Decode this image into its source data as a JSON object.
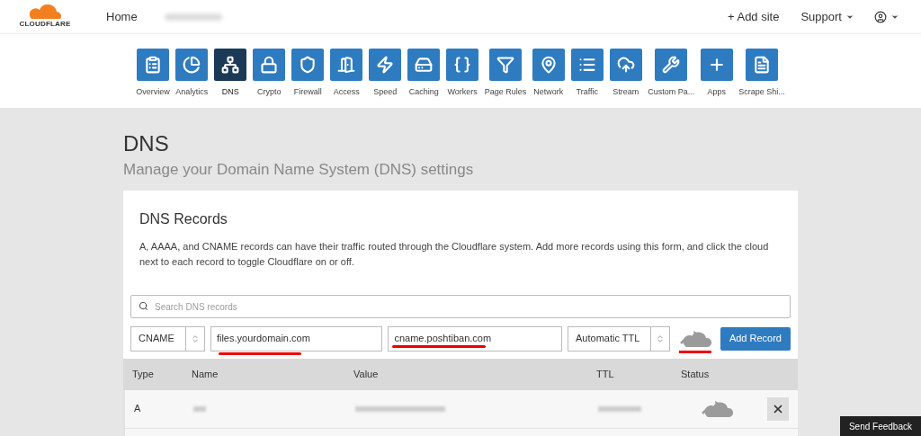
{
  "header": {
    "logo": "CLOUDFLARE",
    "home": "Home",
    "add_site": "+ Add site",
    "support": "Support"
  },
  "nav": [
    {
      "label": "Overview",
      "selected": false
    },
    {
      "label": "Analytics",
      "selected": false
    },
    {
      "label": "DNS",
      "selected": true
    },
    {
      "label": "Crypto",
      "selected": false
    },
    {
      "label": "Firewall",
      "selected": false
    },
    {
      "label": "Access",
      "selected": false
    },
    {
      "label": "Speed",
      "selected": false
    },
    {
      "label": "Caching",
      "selected": false
    },
    {
      "label": "Workers",
      "selected": false
    },
    {
      "label": "Page Rules",
      "selected": false
    },
    {
      "label": "Network",
      "selected": false
    },
    {
      "label": "Traffic",
      "selected": false
    },
    {
      "label": "Stream",
      "selected": false
    },
    {
      "label": "Custom Pa...",
      "selected": false
    },
    {
      "label": "Apps",
      "selected": false
    },
    {
      "label": "Scrape Shi...",
      "selected": false
    }
  ],
  "page": {
    "title": "DNS",
    "subtitle": "Manage your Domain Name System (DNS) settings"
  },
  "card": {
    "title": "DNS Records",
    "description": "A, AAAA, and CNAME records can have their traffic routed through the Cloudflare system. Add more records using this form, and click the cloud next to each record to toggle Cloudflare on or off.",
    "search": {
      "placeholder": "Search DNS records"
    },
    "form": {
      "type": "CNAME",
      "name": "files.yourdomain.com",
      "value": "cname.poshtiban.com",
      "ttl": "Automatic TTL",
      "button": "Add Record"
    },
    "columns": [
      "Type",
      "Name",
      "Value",
      "TTL",
      "Status"
    ],
    "rows": [
      {
        "type": "A"
      },
      {}
    ]
  },
  "feedback": "Send Feedback"
}
